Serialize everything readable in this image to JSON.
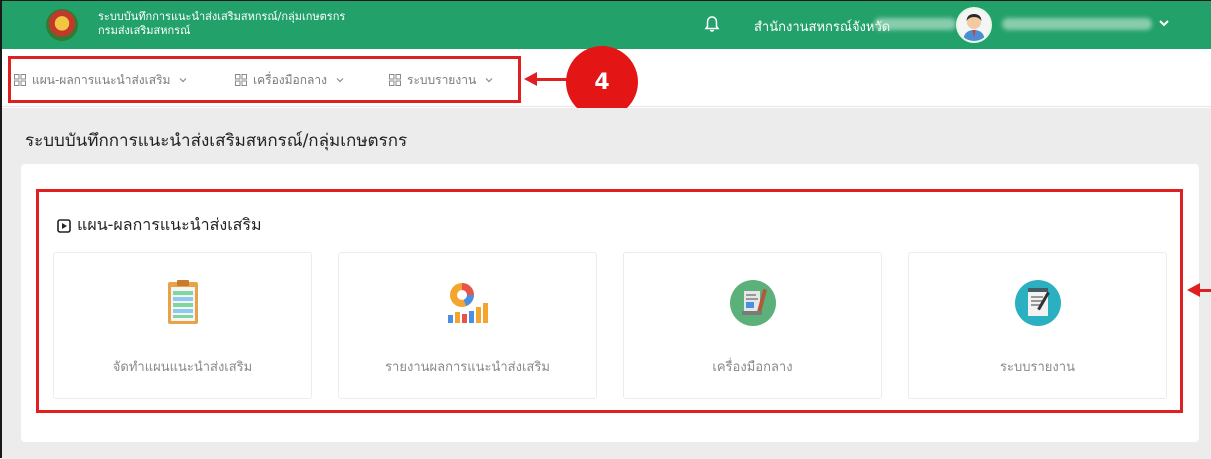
{
  "header": {
    "title_line1": "ระบบบันทึกการแนะนำส่งเสริมสหกรณ์/กลุ่มเกษตรกร",
    "title_line2": "กรมส่งเสริมสหกรณ์",
    "office_label": "สำนักงานสหกรณ์จังหวัด",
    "logo_icon": "department-seal-icon",
    "bell_icon": "bell-icon",
    "caret_icon": "chevron-down-icon",
    "accent_color": "#23a16a"
  },
  "menu": {
    "items": [
      {
        "label": "แผน-ผลการแนะนำส่งเสริม",
        "icon": "grid-icon"
      },
      {
        "label": "เครื่องมือกลาง",
        "icon": "grid-icon"
      },
      {
        "label": "ระบบรายงาน",
        "icon": "grid-icon"
      }
    ]
  },
  "annotation": {
    "badge_number": "4",
    "highlight_color": "#e02020"
  },
  "page": {
    "title": "ระบบบันทึกการแนะนำส่งเสริมสหกรณ์/กลุ่มเกษตรกร"
  },
  "section": {
    "title": "แผน-ผลการแนะนำส่งเสริม",
    "icon": "play-square-icon",
    "cards": [
      {
        "label": "จัดทำแผนแนะนำส่งเสริม",
        "icon": "clipboard-plan-icon"
      },
      {
        "label": "รายงานผลการแนะนำส่งเสริม",
        "icon": "chart-report-icon"
      },
      {
        "label": "เครื่องมือกลาง",
        "icon": "document-tools-icon"
      },
      {
        "label": "ระบบรายงาน",
        "icon": "report-notepad-icon"
      }
    ]
  }
}
